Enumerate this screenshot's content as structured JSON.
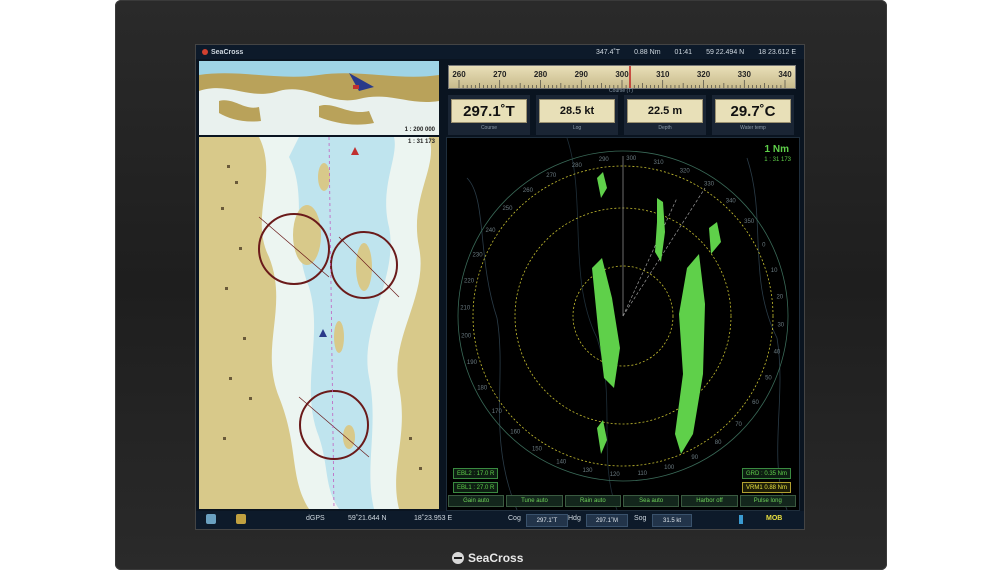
{
  "brand": "SeaCross",
  "topbar": {
    "app_title": "SeaCross",
    "heading": "347.4˚T",
    "distance": "0.88 Nm",
    "time": "01:41",
    "lat": "59 22.494 N",
    "lon": "18 23.612 E"
  },
  "compass": {
    "ticks": [
      "260",
      "270",
      "280",
      "290",
      "300",
      "310",
      "320",
      "330",
      "340"
    ],
    "caption": "Course (T)"
  },
  "readouts": [
    {
      "value": "297.1˚T",
      "caption": "Course"
    },
    {
      "value": "28.5 kt",
      "caption": "Log"
    },
    {
      "value": "22.5 m",
      "caption": "Depth"
    },
    {
      "value": "29.7˚C",
      "caption": "Water temp"
    }
  ],
  "overview": {
    "scale": "1 : 200 000"
  },
  "chart": {
    "scale": "1 : 31 173"
  },
  "radar": {
    "range": "1 Nm",
    "scale": "1 : 31 173",
    "ebl2": "EBL2 : 17.0 R",
    "ebl1": "EBL1 : 27.0 R",
    "grd": "GRD : 0.35 Nm",
    "vrm": "VRM1 0.88 Nm",
    "bearings": [
      "270",
      "280",
      "290",
      "300",
      "310",
      "320",
      "330",
      "340",
      "350",
      "0",
      "10",
      "20",
      "30",
      "40",
      "50",
      "60",
      "70",
      "80",
      "90",
      "100",
      "110",
      "120",
      "130",
      "140",
      "150",
      "160",
      "170",
      "180",
      "190",
      "200",
      "210",
      "220",
      "230",
      "240",
      "250",
      "260"
    ],
    "buttons": [
      "Gain auto",
      "Tune auto",
      "Rain auto",
      "Sea auto",
      "Harbor off",
      "Pulse long"
    ]
  },
  "bottombar": {
    "gps": "dGPS",
    "lat": "59˚21.644 N",
    "lon": "18˚23.953 E",
    "cog_label": "Cog",
    "cog": "297.1˚T",
    "hdg_label": "Hdg",
    "hdg": "297.1˚M",
    "sog_label": "Sog",
    "sog": "31.5 kt",
    "mob": "MOB"
  }
}
